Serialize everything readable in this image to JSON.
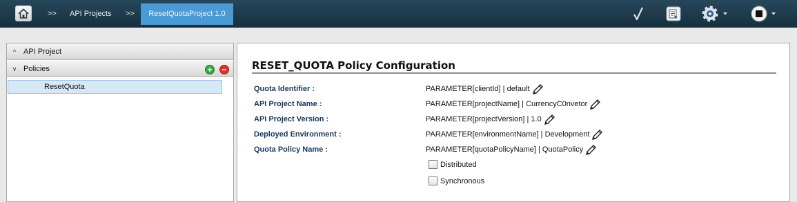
{
  "header": {
    "home_icon": "home-icon",
    "breadcrumbs": [
      {
        "sep": ">>",
        "label": "API Projects"
      },
      {
        "sep": ">>",
        "label": "ResetQuotaProject 1.0"
      }
    ],
    "tools": [
      "validate-check-icon",
      "deploy-document-icon",
      "settings-gear-icon",
      "stop-icon"
    ]
  },
  "sidebar": {
    "sections": [
      {
        "label": "API Project",
        "expanded": false
      },
      {
        "label": "Policies",
        "expanded": true
      }
    ],
    "items": [
      {
        "label": "ResetQuota"
      }
    ]
  },
  "main": {
    "title": "RESET_QUOTA Policy Configuration",
    "fields": [
      {
        "label": "Quota Identifier :",
        "value": "PARAMETER[clientId] | default"
      },
      {
        "label": "API Project Name :",
        "value": "PARAMETER[projectName] | CurrencyC0nvetor"
      },
      {
        "label": "API Project Version :",
        "value": "PARAMETER[projectVersion] | 1.0"
      },
      {
        "label": "Deployed Environment :",
        "value": "PARAMETER[environmentName] | Development"
      },
      {
        "label": "Quota Policy Name :",
        "value": "PARAMETER[quotaPolicyName] | QuotaPolicy"
      }
    ],
    "checkboxes": [
      {
        "label": "Distributed",
        "checked": false
      },
      {
        "label": "Synchronous",
        "checked": false
      }
    ]
  },
  "colors": {
    "topbar": "#1e3a4b",
    "active_crumb": "#4a9ad6",
    "label_blue": "#163b62",
    "add_green": "#3aa53a",
    "remove_red": "#d9342b"
  }
}
